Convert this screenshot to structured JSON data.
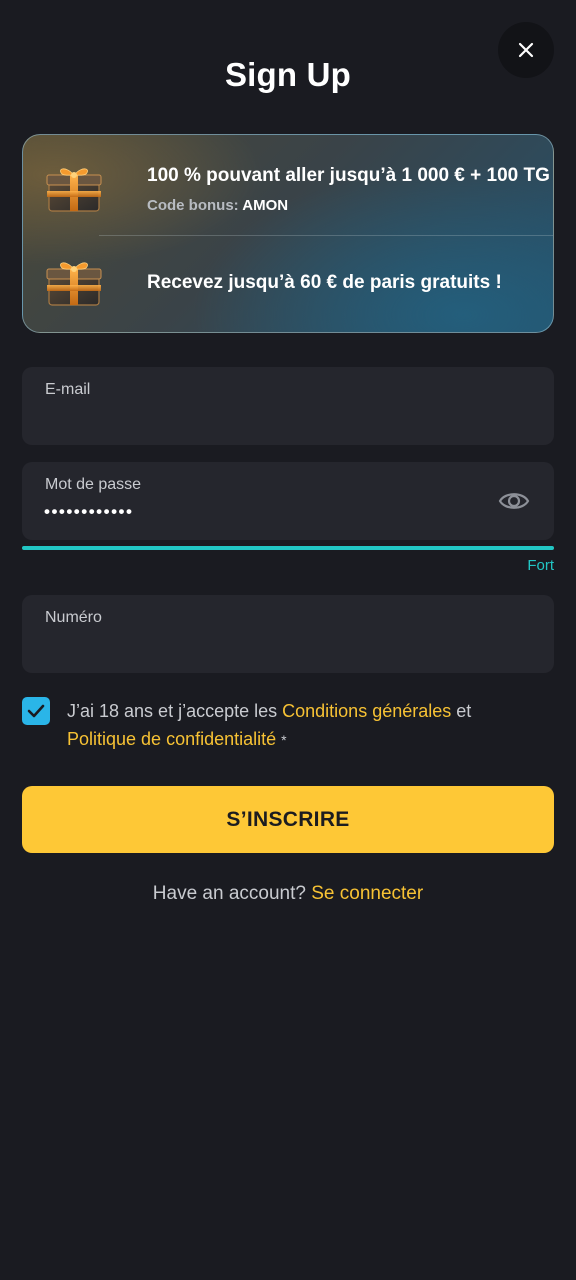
{
  "header": {
    "title": "Sign Up",
    "close_icon": "close-icon"
  },
  "promo": {
    "offers": [
      {
        "icon": "gift-box-icon",
        "text": "100 % pouvant aller jusqu’à 1 000 € + 100 TG",
        "sub_label": "Code bonus:",
        "sub_value": "AMON"
      },
      {
        "icon": "gift-box-icon",
        "text": "Recevez jusqu’à 60 € de paris gratuits !"
      }
    ]
  },
  "form": {
    "email": {
      "label": "E-mail",
      "value": ""
    },
    "password": {
      "label": "Mot de passe",
      "value_masked": "••••••••••••",
      "toggle_icon": "eye-icon"
    },
    "password_strength": {
      "label": "Fort",
      "level": 1.0,
      "color": "#22c6c4"
    },
    "phone": {
      "label": "Numéro",
      "value": ""
    },
    "terms": {
      "checked": true,
      "prefix": "J’ai 18 ans et j’accepte les",
      "conditions_link": "Conditions générales",
      "conjunction": "et",
      "privacy_link": "Politique de confidentialité",
      "required_mark": "*"
    },
    "submit_label": "S’INSCRIRE"
  },
  "footer": {
    "question": "Have an account?",
    "login_link": "Se connecter"
  },
  "colors": {
    "background": "#1a1b21",
    "field_bg": "#25262d",
    "accent_yellow": "#fec836",
    "link_yellow": "#f7c234",
    "checkbox_blue": "#2ab5e8",
    "strength_teal": "#22c6c4"
  }
}
